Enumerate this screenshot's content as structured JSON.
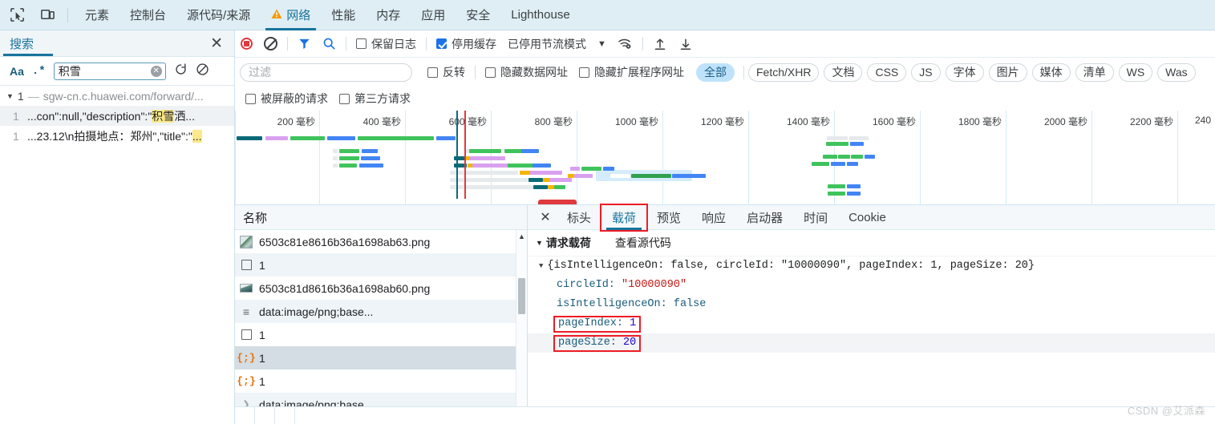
{
  "devtools": {
    "icons": [
      "inspect-icon",
      "device-toolbar-icon"
    ],
    "tabs": [
      {
        "label": "元素",
        "active": false,
        "warn": false
      },
      {
        "label": "控制台",
        "active": false,
        "warn": false
      },
      {
        "label": "源代码/来源",
        "active": false,
        "warn": false
      },
      {
        "label": "网络",
        "active": true,
        "warn": true
      },
      {
        "label": "性能",
        "active": false,
        "warn": false
      },
      {
        "label": "内存",
        "active": false,
        "warn": false
      },
      {
        "label": "应用",
        "active": false,
        "warn": false
      },
      {
        "label": "安全",
        "active": false,
        "warn": false
      },
      {
        "label": "Lighthouse",
        "active": false,
        "warn": false
      }
    ]
  },
  "search_panel": {
    "title": "搜索",
    "close_label": "✕",
    "match_case_label": "Aa",
    "regex_label": ".*",
    "query_value": "积雪",
    "query_placeholder": "",
    "refresh_icon": "refresh-icon",
    "clear_icon": "clear-icon",
    "group": {
      "triangle": "▼",
      "count": "1",
      "dash": "—",
      "url": "sgw-cn.c.huawei.com/forward/..."
    },
    "results": [
      {
        "line": "1",
        "pre": "...con\":null,\"description\":\"",
        "hit": "积雪",
        "post": "洒...",
        "selected": true
      },
      {
        "line": "1",
        "pre": "...23.12\\n拍摄地点：郑州\",\"title\":\"",
        "hit": "...",
        "post": "",
        "selected": false
      }
    ]
  },
  "network_toolbar": {
    "record_icon": "record-stop-icon",
    "clear_icon": "clear-network-icon",
    "filter_icon": "filter-funnel-icon",
    "search_icon": "search-icon",
    "preserve_log": {
      "label": "保留日志",
      "checked": false
    },
    "disable_cache": {
      "label": "停用缓存",
      "checked": true
    },
    "throttling_label": "已停用节流模式",
    "throttling_caret": "▼",
    "wifi_icon": "network-conditions-icon",
    "import_icon": "import-har-icon",
    "export_icon": "export-har-icon"
  },
  "filter_row": {
    "filter_placeholder": "过滤",
    "filter_value": "",
    "invert": {
      "label": "反转",
      "checked": false
    },
    "hide_data_urls": {
      "label": "隐藏数据网址",
      "checked": false
    },
    "hide_extension_urls": {
      "label": "隐藏扩展程序网址",
      "checked": false
    },
    "types": [
      {
        "label": "全部",
        "active": true
      },
      {
        "label": "Fetch/XHR",
        "active": false
      },
      {
        "label": "文档",
        "active": false
      },
      {
        "label": "CSS",
        "active": false
      },
      {
        "label": "JS",
        "active": false
      },
      {
        "label": "字体",
        "active": false
      },
      {
        "label": "图片",
        "active": false
      },
      {
        "label": "媒体",
        "active": false
      },
      {
        "label": "清单",
        "active": false
      },
      {
        "label": "WS",
        "active": false
      },
      {
        "label": "Was",
        "active": false
      }
    ]
  },
  "options_row": {
    "blocked_requests": {
      "label": "被屏蔽的请求",
      "checked": false
    },
    "third_party": {
      "label": "第三方请求",
      "checked": false
    }
  },
  "overview": {
    "ticks": [
      "200 毫秒",
      "400 毫秒",
      "600 毫秒",
      "800 毫秒",
      "1000 毫秒",
      "1200 毫秒",
      "1400 毫秒",
      "1600 毫秒",
      "1800 毫秒",
      "2000 毫秒",
      "2200 毫秒",
      "240"
    ],
    "dom_content_loaded_color": "#1a5d7a",
    "load_event_color": "#e0393e"
  },
  "requests": {
    "header": "名称",
    "rows": [
      {
        "icon": "image-file-icon",
        "name": "6503c81e8616b36a1698ab63.png",
        "alt": false,
        "selected": false
      },
      {
        "icon": "document-icon",
        "name": "1",
        "alt": true,
        "selected": false
      },
      {
        "icon": "image-file-icon",
        "name": "6503c81d8616b36a1698ab60.png",
        "alt": false,
        "selected": false
      },
      {
        "icon": "manifest-lines-icon",
        "name": "data:image/png;base...",
        "alt": true,
        "selected": false
      },
      {
        "icon": "document-icon",
        "name": "1",
        "alt": false,
        "selected": false
      },
      {
        "icon": "json-icon",
        "name": "1",
        "alt": false,
        "selected": true
      },
      {
        "icon": "json-icon",
        "name": "1",
        "alt": false,
        "selected": false
      },
      {
        "icon": "expand-caret-icon",
        "name": "data:image/png;base...",
        "alt": true,
        "selected": false
      }
    ],
    "scroll_up_icon": "▲",
    "scroll_down_icon": "▼"
  },
  "details": {
    "close_icon": "✕",
    "tabs": [
      {
        "label": "标头",
        "active": false,
        "highlighted": false
      },
      {
        "label": "载荷",
        "active": true,
        "highlighted": true
      },
      {
        "label": "预览",
        "active": false,
        "highlighted": false
      },
      {
        "label": "响应",
        "active": false,
        "highlighted": false
      },
      {
        "label": "启动器",
        "active": false,
        "highlighted": false
      },
      {
        "label": "时间",
        "active": false,
        "highlighted": false
      },
      {
        "label": "Cookie",
        "active": false,
        "highlighted": false
      }
    ],
    "section_title": "请求载荷",
    "section_triangle": "▼",
    "view_source_label": "查看源代码",
    "payload_summary": "{isIntelligenceOn: false, circleId: \"10000090\", pageIndex: 1, pageSize: 20}",
    "payload_rows": [
      {
        "key": "circleId:",
        "value": "\"10000090\"",
        "kind": "string",
        "highlighted": false,
        "shade": false
      },
      {
        "key": "isIntelligenceOn:",
        "value": "false",
        "kind": "keyword",
        "highlighted": false,
        "shade": false
      },
      {
        "key": "pageIndex:",
        "value": "1",
        "kind": "number",
        "highlighted": true,
        "shade": false
      },
      {
        "key": "pageSize:",
        "value": "20",
        "kind": "number",
        "highlighted": true,
        "shade": true
      }
    ]
  },
  "watermark": "CSDN @艾派森"
}
